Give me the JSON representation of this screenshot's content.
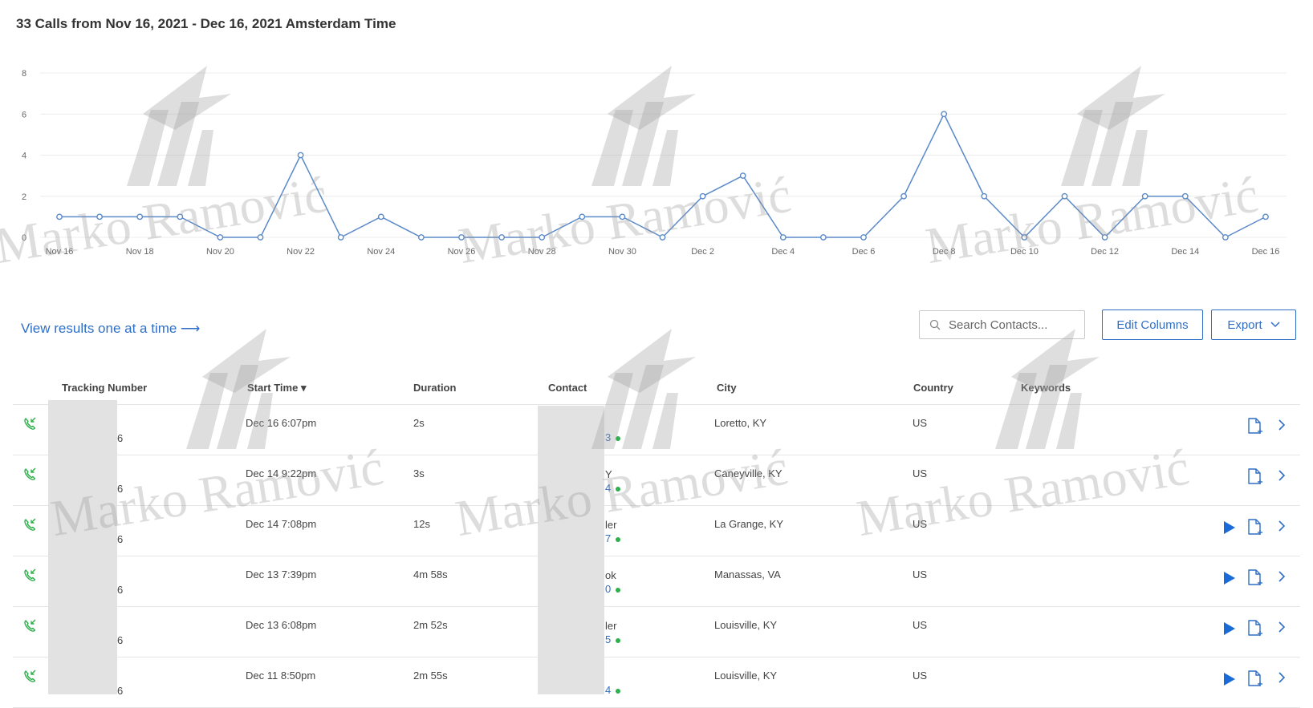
{
  "page": {
    "title": "33 Calls from Nov 16, 2021 - Dec 16, 2021 Amsterdam Time"
  },
  "chart_data": {
    "type": "line",
    "x": [
      "Nov 16",
      "Nov 17",
      "Nov 18",
      "Nov 19",
      "Nov 20",
      "Nov 21",
      "Nov 22",
      "Nov 23",
      "Nov 24",
      "Nov 25",
      "Nov 26",
      "Nov 27",
      "Nov 28",
      "Nov 29",
      "Nov 30",
      "Dec 1",
      "Dec 2",
      "Dec 3",
      "Dec 4",
      "Dec 5",
      "Dec 6",
      "Dec 7",
      "Dec 8",
      "Dec 9",
      "Dec 10",
      "Dec 11",
      "Dec 12",
      "Dec 13",
      "Dec 14",
      "Dec 15",
      "Dec 16"
    ],
    "series": [
      {
        "values": [
          1,
          1,
          1,
          1,
          0,
          0,
          4,
          0,
          1,
          0,
          0,
          0,
          0,
          1,
          1,
          0,
          2,
          3,
          0,
          0,
          0,
          2,
          6,
          2,
          0,
          2,
          0,
          2,
          2,
          0,
          1
        ]
      }
    ],
    "xticks": [
      "Nov 16",
      "Nov 18",
      "Nov 20",
      "Nov 22",
      "Nov 24",
      "Nov 26",
      "Nov 28",
      "Nov 30",
      "Dec 2",
      "Dec 4",
      "Dec 6",
      "Dec 8",
      "Dec 10",
      "Dec 12",
      "Dec 14",
      "Dec 16"
    ],
    "yticks": [
      0,
      2,
      4,
      6,
      8
    ],
    "ylim": [
      0,
      8
    ],
    "grid": true,
    "colors": {
      "line": "#5b8ac9",
      "grid": "#ececec"
    }
  },
  "results_link": "View results one at a time ⟶",
  "search": {
    "placeholder": "Search Contacts..."
  },
  "buttons": {
    "edit_columns": "Edit Columns",
    "export": "Export"
  },
  "table": {
    "headers": {
      "tracking_number": "Tracking Number",
      "start_time": "Start Time ▾",
      "duration": "Duration",
      "contact": "Contact",
      "city": "City",
      "country": "Country",
      "keywords": "Keywords"
    },
    "rows": [
      {
        "tracking_tail": "6",
        "start_time": "Dec 16 6:07pm",
        "duration": "2s",
        "contact_line1": "",
        "contact_line2": "3",
        "city": "Loretto, KY",
        "country": "US",
        "has_recording": false
      },
      {
        "tracking_tail": "6",
        "start_time": "Dec 14 9:22pm",
        "duration": "3s",
        "contact_line1": "Y",
        "contact_line2": "4",
        "city": "Caneyville, KY",
        "country": "US",
        "has_recording": false
      },
      {
        "tracking_tail": "6",
        "start_time": "Dec 14 7:08pm",
        "duration": "12s",
        "contact_line1": "ler",
        "contact_line2": "7",
        "city": "La Grange, KY",
        "country": "US",
        "has_recording": true
      },
      {
        "tracking_tail": "6",
        "start_time": "Dec 13 7:39pm",
        "duration": "4m 58s",
        "contact_line1": "ok",
        "contact_line2": "0",
        "city": "Manassas, VA",
        "country": "US",
        "has_recording": true
      },
      {
        "tracking_tail": "6",
        "start_time": "Dec 13 6:08pm",
        "duration": "2m 52s",
        "contact_line1": "ler",
        "contact_line2": "5",
        "city": "Louisville, KY",
        "country": "US",
        "has_recording": true
      },
      {
        "tracking_tail": "6",
        "start_time": "Dec 11 8:50pm",
        "duration": "2m 55s",
        "contact_line1": "",
        "contact_line2": "4",
        "city": "Louisville, KY",
        "country": "US",
        "has_recording": true
      }
    ]
  },
  "icons": {
    "row_status": "phone-incoming-icon",
    "play": "play-icon",
    "note": "note-add-icon",
    "chevron": "chevron-right-icon",
    "search": "search-icon",
    "export_caret": "chevron-down-icon"
  },
  "colors": {
    "accent": "#2f6fc6",
    "call_icon": "#2db04b",
    "play": "#1a6ad8"
  },
  "watermark": "Marko Ramović"
}
